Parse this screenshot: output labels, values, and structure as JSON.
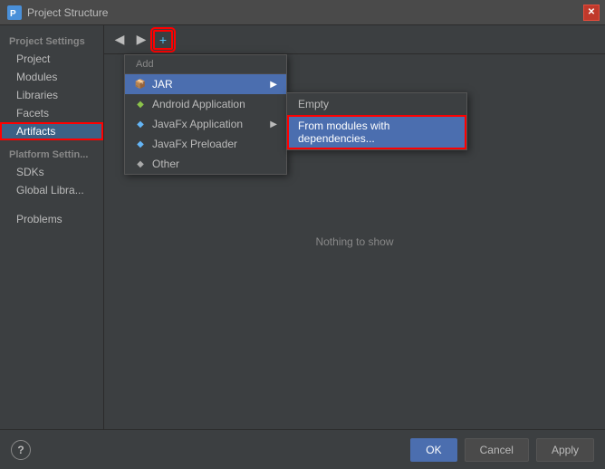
{
  "titleBar": {
    "title": "Project Structure",
    "closeLabel": "✕"
  },
  "toolbar": {
    "backLabel": "◀",
    "forwardLabel": "▶",
    "addLabel": "+"
  },
  "sidebar": {
    "projectSettingsTitle": "Project Settings",
    "items": [
      {
        "id": "project",
        "label": "Project"
      },
      {
        "id": "modules",
        "label": "Modules"
      },
      {
        "id": "libraries",
        "label": "Libraries"
      },
      {
        "id": "facets",
        "label": "Facets"
      },
      {
        "id": "artifacts",
        "label": "Artifacts",
        "active": true
      }
    ],
    "platformTitle": "Platform Settin...",
    "platformItems": [
      {
        "id": "sdks",
        "label": "SDKs"
      },
      {
        "id": "global-libraries",
        "label": "Global Libra..."
      }
    ],
    "problemsLabel": "Problems"
  },
  "addMenu": {
    "headerLabel": "Add",
    "items": [
      {
        "id": "jar",
        "label": "JAR",
        "icon": "jar-icon",
        "hasSubmenu": true,
        "active": true
      },
      {
        "id": "android-application",
        "label": "Android Application",
        "icon": "android-icon",
        "hasSubmenu": false
      },
      {
        "id": "javafx-application",
        "label": "JavaFx Application",
        "icon": "javafx-icon",
        "hasSubmenu": true
      },
      {
        "id": "javafx-preloader",
        "label": "JavaFx Preloader",
        "icon": "javafx-icon",
        "hasSubmenu": false
      },
      {
        "id": "other",
        "label": "Other",
        "icon": "other-icon",
        "hasSubmenu": false
      }
    ]
  },
  "jarSubmenu": {
    "items": [
      {
        "id": "empty",
        "label": "Empty"
      },
      {
        "id": "from-modules",
        "label": "From modules with dependencies...",
        "highlighted": true
      }
    ]
  },
  "rightPanel": {
    "nothingToShow": "Nothing to show"
  },
  "bottomBar": {
    "helpLabel": "?",
    "okLabel": "OK",
    "cancelLabel": "Cancel",
    "applyLabel": "Apply"
  }
}
